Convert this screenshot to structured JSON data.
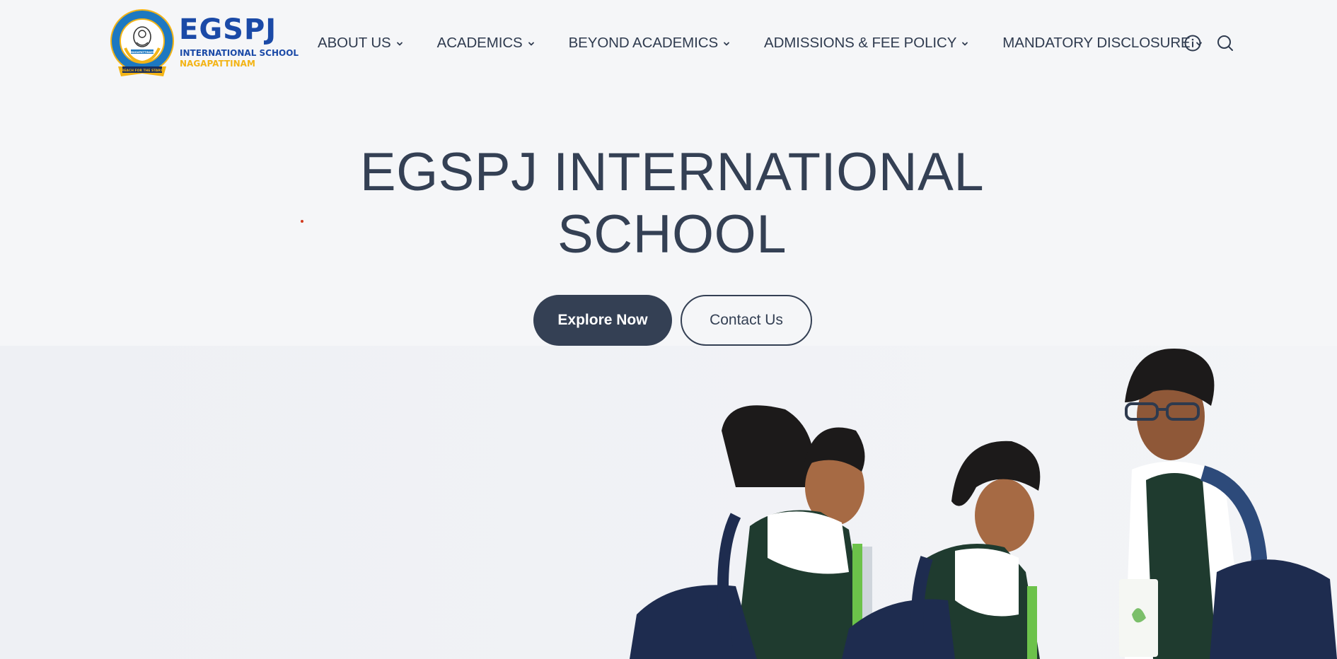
{
  "logo": {
    "title": "EGSPJ",
    "subtitle": "INTERNATIONAL SCHOOL",
    "city": "NAGAPATTINAM",
    "emblem_ring_text": "EGSPJ INTERNATIONAL SCHOOL",
    "emblem_ribbon_text": "NAGAPATTINAM",
    "emblem_motto": "REACH FOR THE STARS"
  },
  "nav": {
    "items": [
      {
        "label": "ABOUT US"
      },
      {
        "label": "ACADEMICS"
      },
      {
        "label": "BEYOND ACADEMICS"
      },
      {
        "label": "ADMISSIONS & FEE POLICY"
      },
      {
        "label": "MANDATORY DISCLOSURE"
      }
    ],
    "icons": [
      "info-icon",
      "search-icon"
    ]
  },
  "hero": {
    "title_line1": "EGSPJ INTERNATIONAL",
    "title_line2": "SCHOOL",
    "primary_button": "Explore Now",
    "secondary_button": "Contact Us"
  },
  "colors": {
    "background": "#f5f6f8",
    "text": "#344054",
    "brand_blue": "#1b4aa7",
    "brand_yellow": "#f3b416",
    "button_dark": "#344054"
  }
}
